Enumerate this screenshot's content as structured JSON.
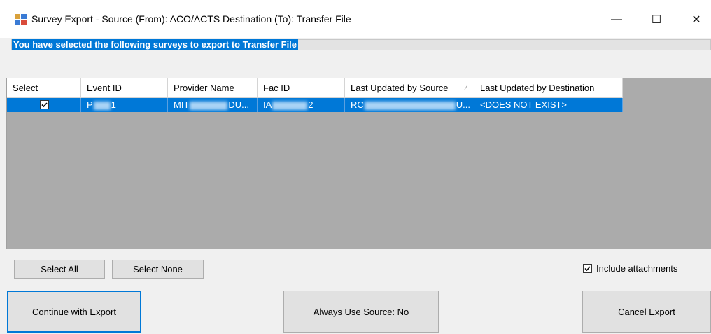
{
  "window": {
    "title": "Survey Export - Source (From): ACO/ACTS  Destination (To): Transfer File",
    "minimize_symbol": "—",
    "maximize_symbol": "☐",
    "close_symbol": "✕"
  },
  "banner": {
    "text": "You have selected the following surveys to export to Transfer File"
  },
  "table": {
    "columns": [
      "Select",
      "Event ID",
      "Provider Name",
      "Fac ID",
      "Last Updated by Source",
      "Last Updated by Destination"
    ],
    "sort_indicator": "⁄",
    "rows": [
      {
        "selected": true,
        "event_id_start": "P",
        "event_id_end": "1",
        "provider_start": "MIT",
        "provider_end": "DU...",
        "fac_id_start": "IA",
        "fac_id_end": "2",
        "source_start": "RC",
        "source_end": "U...",
        "destination": "<DOES NOT EXIST>"
      }
    ]
  },
  "buttons": {
    "select_all": "Select All",
    "select_none": "Select None",
    "continue_export": "Continue with Export",
    "always_use_source": "Always Use Source: No",
    "cancel_export": "Cancel Export"
  },
  "include_attachments": {
    "label": "Include attachments",
    "checked": true
  },
  "icons": {
    "app": "survey-export-app-icon",
    "check": "checkmark-icon"
  }
}
